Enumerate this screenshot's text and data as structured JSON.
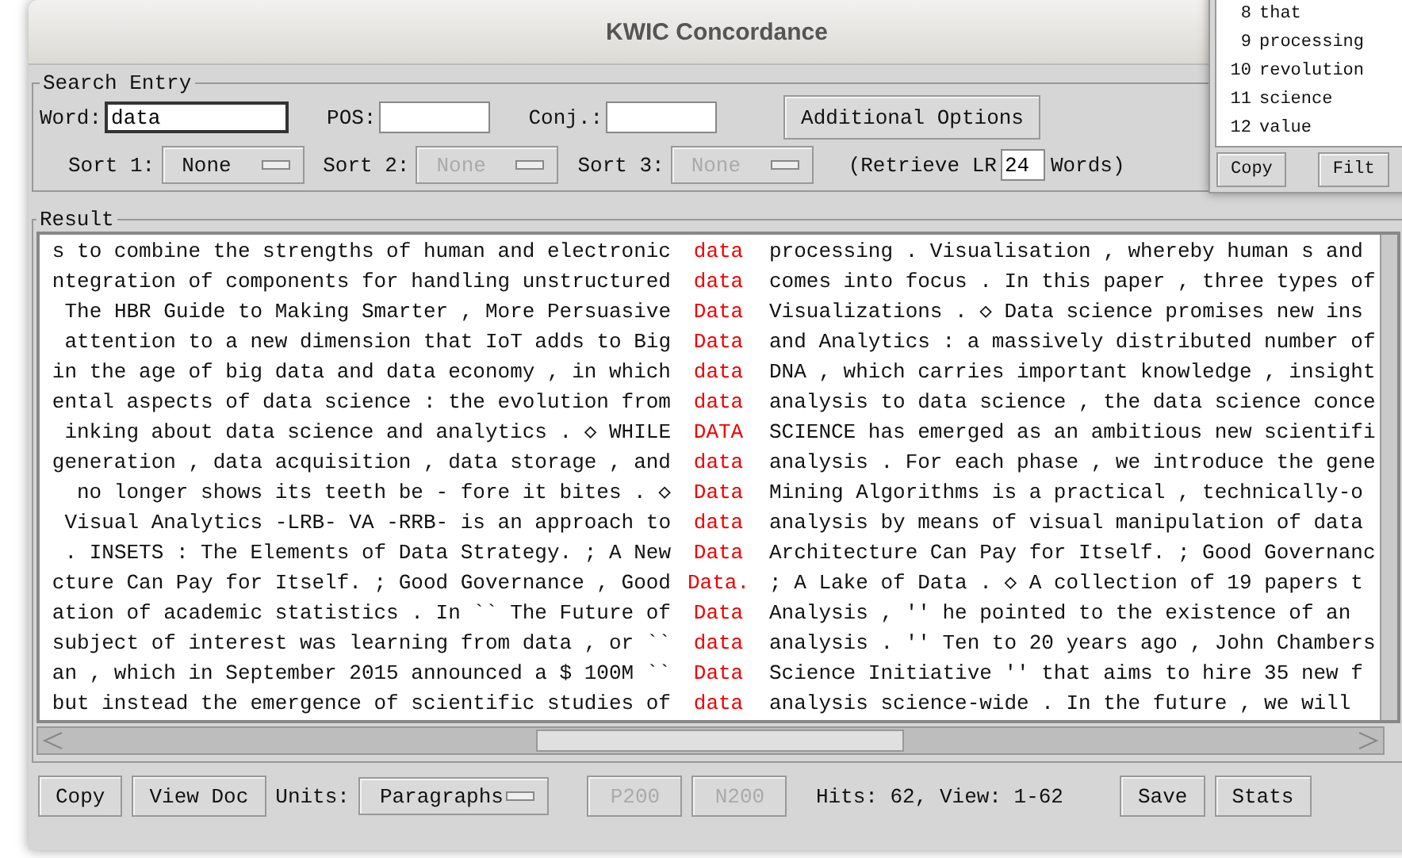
{
  "window": {
    "title": "KWIC Concordance"
  },
  "search_entry": {
    "label": "Search Entry",
    "word_label": "Word:",
    "word": "data",
    "pos_label": "POS:",
    "conj_label": "Conj.:",
    "options_button": "Additional Options",
    "sorts": [
      {
        "label": "Sort 1:",
        "value": "None",
        "disabled": false
      },
      {
        "label": "Sort 2:",
        "value": "None",
        "disabled": true
      },
      {
        "label": "Sort 3:",
        "value": "None",
        "disabled": true
      }
    ],
    "retrieve_prefix": "(Retrieve LR",
    "retrieve_value": "24",
    "retrieve_suffix": "Words)"
  },
  "result": {
    "label": "Result",
    "rows": [
      {
        "left": "s to combine the strengths of human and electronic",
        "keyword": "data",
        "right": "processing . Visualisation , whereby human s and"
      },
      {
        "left": "ntegration of components for handling unstructured",
        "keyword": "data",
        "right": "comes into focus . In this paper , three types of"
      },
      {
        "left": "The HBR Guide to Making Smarter , More Persuasive",
        "keyword": "Data",
        "right": "Visualizations . ◇ Data science promises new ins"
      },
      {
        "left": "attention to a new dimension that IoT adds to Big",
        "keyword": "Data",
        "right": "and Analytics : a massively distributed number of"
      },
      {
        "left": "in the age of big data and data economy , in which",
        "keyword": "data",
        "right": "DNA , which carries important knowledge , insight"
      },
      {
        "left": "ental aspects of data science : the evolution from",
        "keyword": "data",
        "right": "analysis to data science , the data science conce"
      },
      {
        "left": "inking about data science and analytics . ◇ WHILE",
        "keyword": "DATA",
        "right": "SCIENCE has emerged as an ambitious new scientifi"
      },
      {
        "left": "generation , data acquisition , data storage , and",
        "keyword": "data",
        "right": "analysis . For each phase , we introduce the gene"
      },
      {
        "left": "no longer shows its teeth be - fore it bites . ◇",
        "keyword": "Data",
        "right": "Mining Algorithms is a practical , technically-o"
      },
      {
        "left": "Visual Analytics -LRB- VA -RRB- is an approach to",
        "keyword": "data",
        "right": "analysis by means of visual manipulation of data"
      },
      {
        "left": ". INSETS : The Elements of Data Strategy. ; A New",
        "keyword": "Data",
        "right": "Architecture Can Pay for Itself. ; Good Governanc"
      },
      {
        "left": "cture Can Pay for Itself. ; Good Governance , Good",
        "keyword": "Data.",
        "right": "; A Lake of Data . ◇ A collection of 19 papers t"
      },
      {
        "left": "ation of academic statistics . In `` The Future of",
        "keyword": "Data",
        "right": "Analysis , '' he pointed to the existence of an"
      },
      {
        "left": "subject of interest was learning from data , or ``",
        "keyword": "data",
        "right": "analysis . '' Ten to 20 years ago , John Chambers"
      },
      {
        "left": "an , which in September 2015 announced a $ 100M ``",
        "keyword": "Data",
        "right": "Science Initiative '' that aims to hire 35 new f"
      },
      {
        "left": "but instead the emergence of scientific studies of",
        "keyword": "data",
        "right": "analysis science-wide . In the future , we will"
      }
    ]
  },
  "bottom_bar": {
    "copy": "Copy",
    "view_doc": "View Doc",
    "units_label": "Units:",
    "units": "Paragraphs",
    "prev": {
      "label": "P200",
      "disabled": true
    },
    "next": {
      "label": "N200",
      "disabled": true
    },
    "status": "Hits: 62, View: 1-62",
    "save": "Save",
    "stats": "Stats"
  },
  "word_list": {
    "items": [
      {
        "rank": "8",
        "word": "that"
      },
      {
        "rank": "9",
        "word": "processing"
      },
      {
        "rank": "10",
        "word": "revolution"
      },
      {
        "rank": "11",
        "word": "science"
      },
      {
        "rank": "12",
        "word": "value"
      }
    ],
    "buttons": [
      "Copy",
      "Filt"
    ]
  }
}
